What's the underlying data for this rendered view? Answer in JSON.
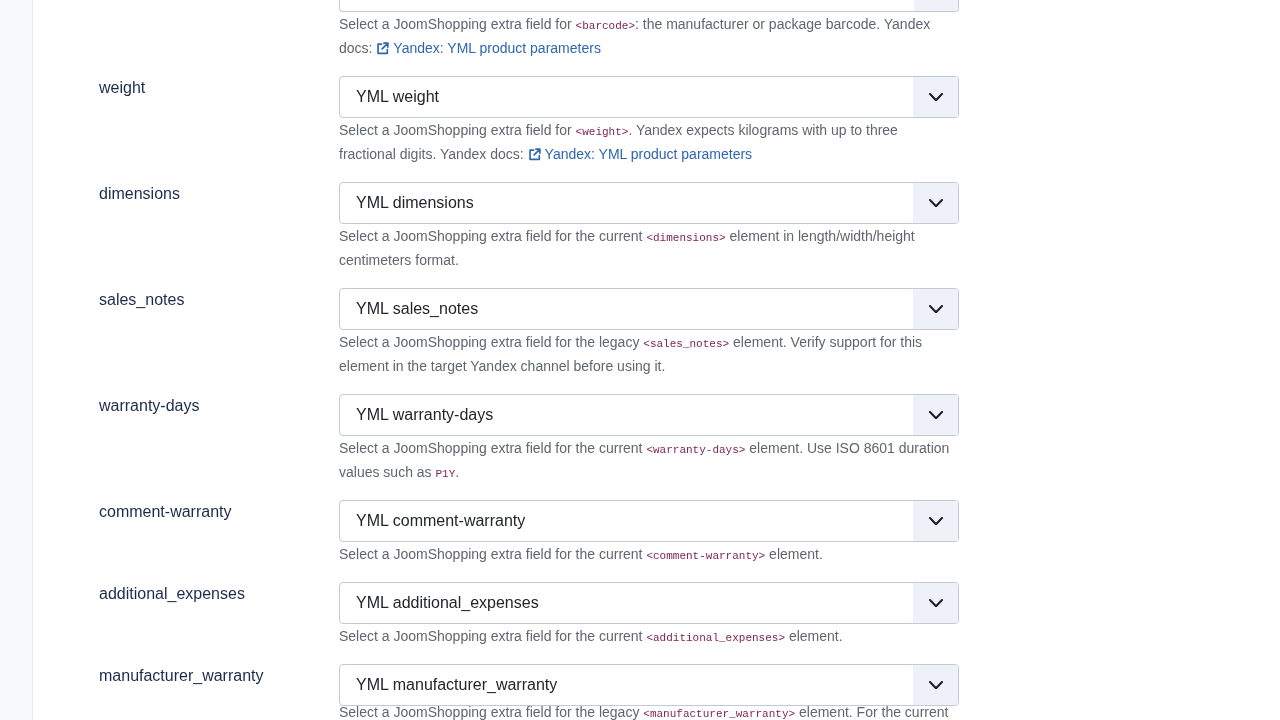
{
  "partial_field": {
    "description": [
      {
        "kind": "text",
        "text": "Select a JoomShopping extra field for "
      },
      {
        "kind": "code",
        "text": "<barcode>"
      },
      {
        "kind": "text",
        "text": ": the manufacturer or package barcode. Yandex docs: "
      },
      {
        "kind": "link",
        "text": "Yandex: YML product parameters"
      }
    ]
  },
  "fields": [
    {
      "label": "weight",
      "value": "YML weight",
      "description": [
        {
          "kind": "text",
          "text": "Select a JoomShopping extra field for "
        },
        {
          "kind": "code",
          "text": "<weight>"
        },
        {
          "kind": "text",
          "text": ". Yandex expects kilograms with up to three fractional digits. Yandex docs: "
        },
        {
          "kind": "link",
          "text": "Yandex: YML product parameters"
        }
      ]
    },
    {
      "label": "dimensions",
      "value": "YML dimensions",
      "description": [
        {
          "kind": "text",
          "text": "Select a JoomShopping extra field for the current "
        },
        {
          "kind": "code",
          "text": "<dimensions>"
        },
        {
          "kind": "text",
          "text": " element in length/width/height centimeters format."
        }
      ]
    },
    {
      "label": "sales_notes",
      "value": "YML sales_notes",
      "description": [
        {
          "kind": "text",
          "text": "Select a JoomShopping extra field for the legacy "
        },
        {
          "kind": "code",
          "text": "<sales_notes>"
        },
        {
          "kind": "text",
          "text": " element. Verify support for this element in the target Yandex channel before using it."
        }
      ]
    },
    {
      "label": "warranty-days",
      "value": "YML warranty-days",
      "description": [
        {
          "kind": "text",
          "text": "Select a JoomShopping extra field for the current "
        },
        {
          "kind": "code",
          "text": "<warranty-days>"
        },
        {
          "kind": "text",
          "text": " element. Use ISO 8601 duration values such as "
        },
        {
          "kind": "code",
          "text": "P1Y"
        },
        {
          "kind": "text",
          "text": "."
        }
      ]
    },
    {
      "label": "comment-warranty",
      "value": "YML comment-warranty",
      "description": [
        {
          "kind": "text",
          "text": "Select a JoomShopping extra field for the current "
        },
        {
          "kind": "code",
          "text": "<comment-warranty>"
        },
        {
          "kind": "text",
          "text": " element."
        }
      ]
    },
    {
      "label": "additional_expenses",
      "value": "YML additional_expenses",
      "description": [
        {
          "kind": "text",
          "text": "Select a JoomShopping extra field for the current "
        },
        {
          "kind": "code",
          "text": "<additional_expenses>"
        },
        {
          "kind": "text",
          "text": " element."
        }
      ]
    },
    {
      "label": "manufacturer_warranty",
      "value": "YML manufacturer_warranty",
      "description": [
        {
          "kind": "text",
          "text": "Select a JoomShopping extra field for the legacy "
        },
        {
          "kind": "code",
          "text": "<manufacturer_warranty>"
        },
        {
          "kind": "text",
          "text": " element. For the current"
        }
      ]
    }
  ]
}
